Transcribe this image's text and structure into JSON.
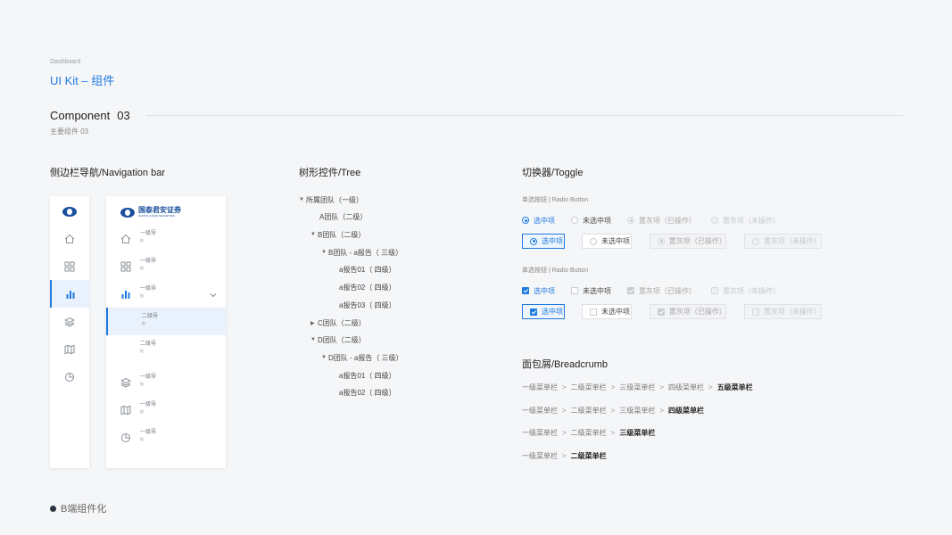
{
  "header": {
    "crumb": "Dashboard",
    "title": "UI Kit – 组件",
    "section_title": "Component",
    "section_num": "03",
    "section_sub": "主要组件 03"
  },
  "columns": {
    "nav": "侧边栏导航/Navigation bar",
    "tree": "树形控件/Tree",
    "toggle": "切换器/Toggle"
  },
  "sidebar": {
    "logo_text": "国泰君安证券",
    "logo_sub": "GUOTAI JUNAN SECURITIES",
    "items": [
      {
        "label": "一级导",
        "sub": "航"
      },
      {
        "label": "一级导",
        "sub": "航"
      },
      {
        "label": "一级导",
        "sub": "航"
      },
      {
        "label": "二级导",
        "sub": "航"
      },
      {
        "label": "二级导",
        "sub": "航"
      },
      {
        "label": "一级导",
        "sub": "航"
      },
      {
        "label": "一级导",
        "sub": "航"
      },
      {
        "label": "一级导",
        "sub": "航"
      }
    ]
  },
  "tree": {
    "nodes": [
      {
        "label": "所属团队（一级）"
      },
      {
        "label": "A团队（二级）"
      },
      {
        "label": "B团队（二级）"
      },
      {
        "label": "B团队 - a报告（ 三级）"
      },
      {
        "label": "a报告01（ 四级）"
      },
      {
        "label": "a报告02（ 四级）"
      },
      {
        "label": "a报告03（ 四级）"
      },
      {
        "label": "C团队（二级）"
      },
      {
        "label": "D团队（二级）"
      },
      {
        "label": "D团队 - a报告（ 三级）"
      },
      {
        "label": "a报告01（ 四级）"
      },
      {
        "label": "a报告02（ 四级）"
      }
    ]
  },
  "toggle": {
    "radio_label": "单选按钮  |  Radio Button",
    "check_label": "单选按钮  |  Radio Button",
    "options": {
      "selected": "选中项",
      "unselected": "未选中项",
      "disabled_done": "置灰项（已操作）",
      "disabled_none": "置灰项（未操作）"
    }
  },
  "breadcrumb": {
    "title": "面包屑/Breadcrumb",
    "rows": [
      [
        "一级菜单栏",
        "二级菜单栏",
        "三级菜单栏",
        "四级菜单栏",
        "五级菜单栏"
      ],
      [
        "一级菜单栏",
        "二级菜单栏",
        "三级菜单栏",
        "四级菜单栏"
      ],
      [
        "一级菜单栏",
        "二级菜单栏",
        "三级菜单栏"
      ],
      [
        "一级菜单栏",
        "二级菜单栏"
      ]
    ]
  },
  "footer": {
    "label": "B端组件化"
  },
  "colors": {
    "accent": "#1f7ae0",
    "active_bg": "#e8f1fc",
    "brand": "#1a4f9c"
  }
}
